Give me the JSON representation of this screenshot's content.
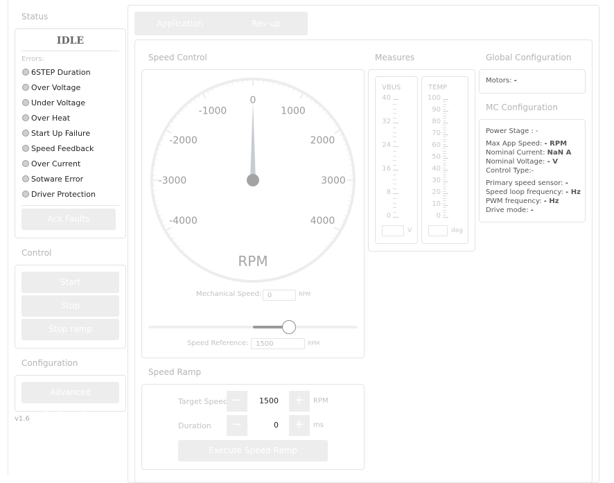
{
  "left": {
    "status_title": "Status",
    "state": "IDLE",
    "errors_label": "Errors:",
    "errors": [
      "6STEP Duration",
      "Over Voltage",
      "Under Voltage",
      "Over Heat",
      "Start Up Failure",
      "Speed Feedback",
      "Over Current",
      "Sotware Error",
      "Driver Protection"
    ],
    "ack_label": "Ack Faults",
    "control_title": "Control",
    "start_label": "Start",
    "stop_label": "Stop",
    "stop_ramp_label": "Stop ramp",
    "config_title": "Configuration",
    "adv_config_label": "Advanced Configuration",
    "version": "v1.6"
  },
  "tabs": [
    {
      "label": "Application"
    },
    {
      "label": "Rev-up"
    }
  ],
  "speed_control": {
    "title": "Speed Control",
    "gauge": {
      "unit": "RPM",
      "ticks": [
        "-4000",
        "-3000",
        "-2000",
        "-1000",
        "0",
        "1000",
        "2000",
        "3000",
        "4000"
      ],
      "value": 0
    },
    "mech_speed_label": "Mechanical Speed:",
    "mech_speed_value": "0",
    "mech_speed_unit": "RPM",
    "slider_value": 1500,
    "speed_ref_label": "Speed Reference:",
    "speed_ref_value": "1500",
    "speed_ref_unit": "RPM"
  },
  "measures": {
    "title": "Measures",
    "vbus": {
      "label": "VBUS",
      "ticks": [
        "40",
        "32",
        "24",
        "16",
        "8",
        "0"
      ],
      "unit": "V",
      "value": ""
    },
    "temp": {
      "label": "TEMP",
      "ticks": [
        "100",
        "90",
        "80",
        "70",
        "60",
        "50",
        "40",
        "30",
        "20",
        "10",
        "0"
      ],
      "unit": "deg",
      "value": ""
    }
  },
  "global_config": {
    "title": "Global Configuration",
    "motors_label": "Motors:",
    "motors_value": "-"
  },
  "mc_config": {
    "title": "MC Configuration",
    "power_stage": "Power Stage : -",
    "max_app_speed_label": "Max App Speed:",
    "max_app_speed_value": "- RPM",
    "nominal_current_label": "Nominal Current:",
    "nominal_current_value": "NaN A",
    "nominal_voltage_label": "Nominal Voltage:",
    "nominal_voltage_value": "- V",
    "control_type": "Control Type:-",
    "primary_sensor_label": "Primary speed sensor:",
    "primary_sensor_value": "-",
    "speed_loop_label": "Speed loop frequency:",
    "speed_loop_value": "- Hz",
    "pwm_label": "PWM frequency:",
    "pwm_value": "- Hz",
    "drive_mode_label": "Drive mode:",
    "drive_mode_value": "-"
  },
  "speed_ramp": {
    "title": "Speed Ramp",
    "target_label": "Target Speed",
    "target_value": "1500",
    "target_unit": "RPM",
    "duration_label": "Duration",
    "duration_value": "0",
    "duration_unit": "ms",
    "minus": "−",
    "plus": "+",
    "execute_label": "Execute Speed Ramp"
  }
}
